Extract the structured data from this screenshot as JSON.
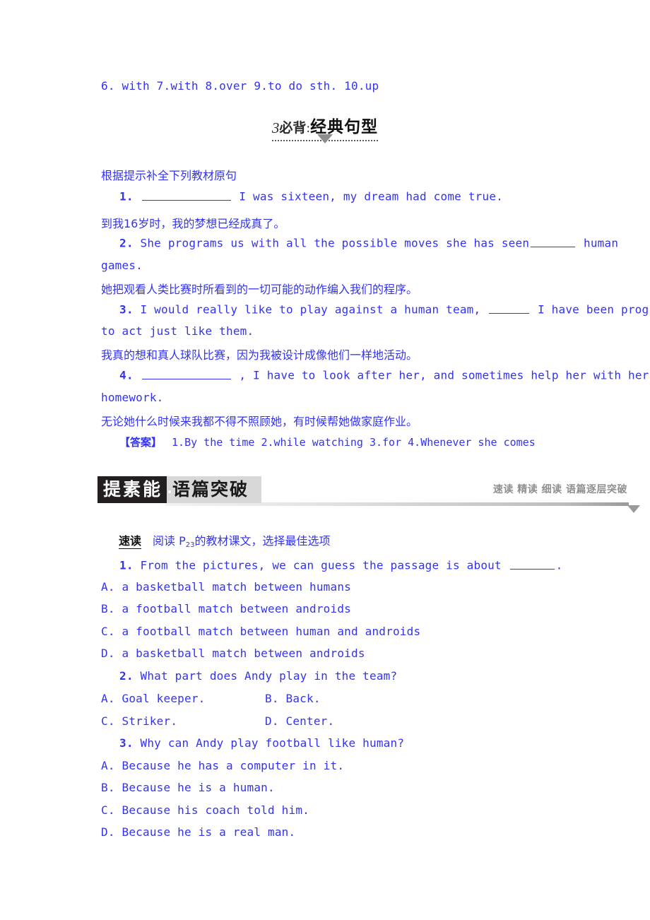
{
  "prev_answers_line": "6. with  7.with  8.over  9.to do sth.   10.up",
  "section_title": {
    "number": "3",
    "prefix": "必背",
    "colon": ":",
    "main": "经典句型",
    "marker_icon": "triangle-down-icon"
  },
  "instruction": "根据提示补全下列教材原句",
  "sentences": [
    {
      "num": "1.",
      "blank_before": true,
      "en_head": "",
      "en_tail": "I was sixteen, my dream had come true.",
      "cn": "到我16岁时，我的梦想已经成真了。"
    },
    {
      "num": "2.",
      "blank_before": false,
      "en_head": "She programs us with all the possible moves she has seen",
      "en_tail": "human games.",
      "cn": "她把观看人类比赛时所看到的一切可能的动作编入我们的程序。"
    },
    {
      "num": "3.",
      "blank_before": false,
      "en_head": "I would really like to play against a human team,",
      "en_tail": "I have been programmed to act just like them.",
      "cn": "我真的想和真人球队比赛，因为我被设计成像他们一样地活动。"
    },
    {
      "num": "4.",
      "blank_before": true,
      "en_head": "",
      "en_tail": ", I have to look after her, and sometimes help her with her homework.",
      "cn": "无论她什么时候来我都不得不照顾她，有时候帮她做家庭作业。"
    }
  ],
  "answers": {
    "label": "【答案】",
    "body": "1.By the time  2.while watching  3.for  4.Whenever she comes"
  },
  "banner": {
    "black_label": "提素能",
    "main_label": "语篇突破",
    "right_label": "速读 精读 细读 语篇逐层突破",
    "marker_icon": "triangle-down-icon"
  },
  "speedread": {
    "tag": "速读",
    "text_before": "阅读 P",
    "subscript": "23",
    "text_after": "的教材课文，选择最佳选项"
  },
  "questions": [
    {
      "num": "1.",
      "stem_before": "From the pictures, we can guess the passage is about",
      "stem_after": ".",
      "has_blank": true,
      "layout": "stacked",
      "options": [
        "A. a basketball match between humans",
        "B. a football match between androids",
        "C. a football match between human and androids",
        "D. a basketball match between androids"
      ]
    },
    {
      "num": "2.",
      "stem_before": "What part does Andy play in the team?",
      "stem_after": "",
      "has_blank": false,
      "layout": "two-column",
      "options": [
        "A. Goal keeper.",
        "B. Back.",
        "C. Striker.",
        "D. Center."
      ]
    },
    {
      "num": "3.",
      "stem_before": "Why can Andy play football like human?",
      "stem_after": "",
      "has_blank": false,
      "layout": "stacked",
      "options": [
        "A. Because he has a computer in it.",
        "B. Because he is a human.",
        "C. Because his coach told him.",
        "D. Because he is a real man."
      ]
    }
  ],
  "colors": {
    "body_blue": "#3333ee",
    "banner_black": "#231f20",
    "banner_gray": "#d8d8d8",
    "marker_gray": "#8f8f8f"
  }
}
